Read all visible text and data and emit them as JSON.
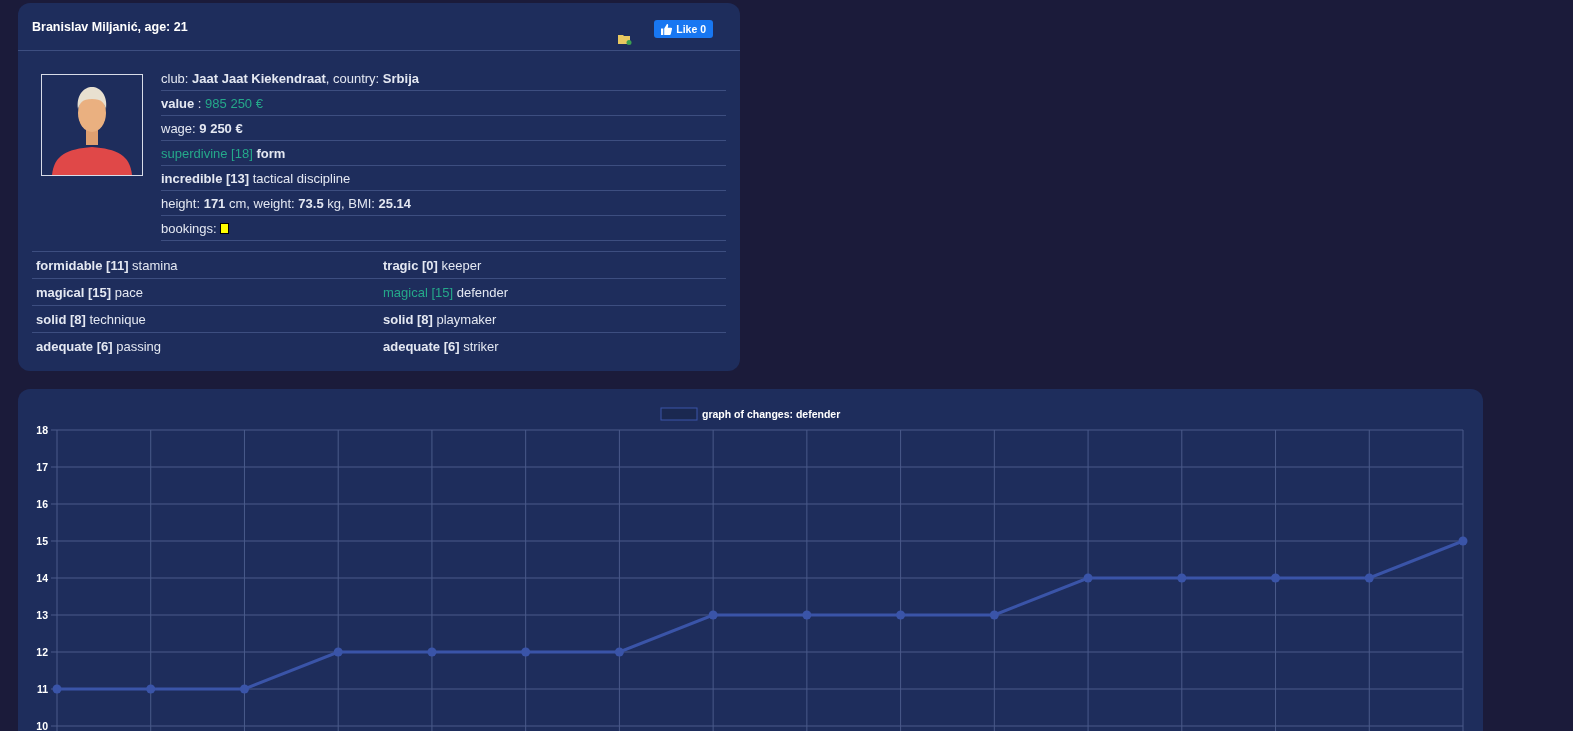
{
  "player": {
    "title": "Branislav Miljanić, age: 21",
    "like_button": {
      "label": "Like 0"
    },
    "info": [
      {
        "segments": [
          {
            "text": "club: ",
            "bold": false,
            "accent": false
          },
          {
            "text": "Jaat Jaat Kiekendraat",
            "bold": true,
            "accent": false
          },
          {
            "text": ", country: ",
            "bold": false,
            "accent": false
          },
          {
            "text": "Srbija",
            "bold": true,
            "accent": false
          }
        ]
      },
      {
        "segments": [
          {
            "text": "value",
            "bold": true,
            "accent": false
          },
          {
            "text": " : ",
            "bold": false,
            "accent": false
          },
          {
            "text": "985 250 €",
            "bold": false,
            "accent": true
          }
        ]
      },
      {
        "segments": [
          {
            "text": "wage: ",
            "bold": false,
            "accent": false
          },
          {
            "text": "9 250 €",
            "bold": true,
            "accent": false
          }
        ]
      },
      {
        "segments": [
          {
            "text": "superdivine [18]",
            "bold": false,
            "accent": true
          },
          {
            "text": " form",
            "bold": true,
            "accent": false
          }
        ]
      },
      {
        "segments": [
          {
            "text": "incredible [13]",
            "bold": true,
            "accent": false
          },
          {
            "text": " tactical discipline",
            "bold": false,
            "accent": false
          }
        ]
      },
      {
        "segments": [
          {
            "text": "height: ",
            "bold": false,
            "accent": false
          },
          {
            "text": "171",
            "bold": true,
            "accent": false
          },
          {
            "text": " cm, weight: ",
            "bold": false,
            "accent": false
          },
          {
            "text": "73.5",
            "bold": true,
            "accent": false
          },
          {
            "text": " kg, BMI: ",
            "bold": false,
            "accent": false
          },
          {
            "text": "25.14",
            "bold": true,
            "accent": false
          }
        ]
      }
    ],
    "bookings": {
      "label": "bookings:",
      "cards": [
        {
          "color": "#ffff00"
        }
      ]
    },
    "skills": [
      {
        "rating": "formidable [11]",
        "name": "stamina",
        "highlighted": false
      },
      {
        "rating": "tragic [0]",
        "name": "keeper",
        "highlighted": false
      },
      {
        "rating": "magical [15]",
        "name": "pace",
        "highlighted": false
      },
      {
        "rating": "magical [15]",
        "name": "defender",
        "highlighted": true
      },
      {
        "rating": "solid [8]",
        "name": "technique",
        "highlighted": false
      },
      {
        "rating": "solid [8]",
        "name": "playmaker",
        "highlighted": false
      },
      {
        "rating": "adequate [6]",
        "name": "passing",
        "highlighted": false
      },
      {
        "rating": "adequate [6]",
        "name": "striker",
        "highlighted": false
      }
    ]
  },
  "graph": {
    "chart_data": {
      "type": "line",
      "grid": true,
      "marker": true,
      "ylim": [
        10,
        18
      ],
      "yticks": [
        10,
        11,
        12,
        13,
        14,
        15,
        16,
        17,
        18
      ],
      "series": [
        {
          "name": "graph of changes: defender",
          "color": "#3a54a8",
          "values": [
            11,
            11,
            11,
            12,
            12,
            12,
            12,
            13,
            13,
            13,
            13,
            14,
            14,
            14,
            14,
            15
          ]
        }
      ]
    }
  }
}
